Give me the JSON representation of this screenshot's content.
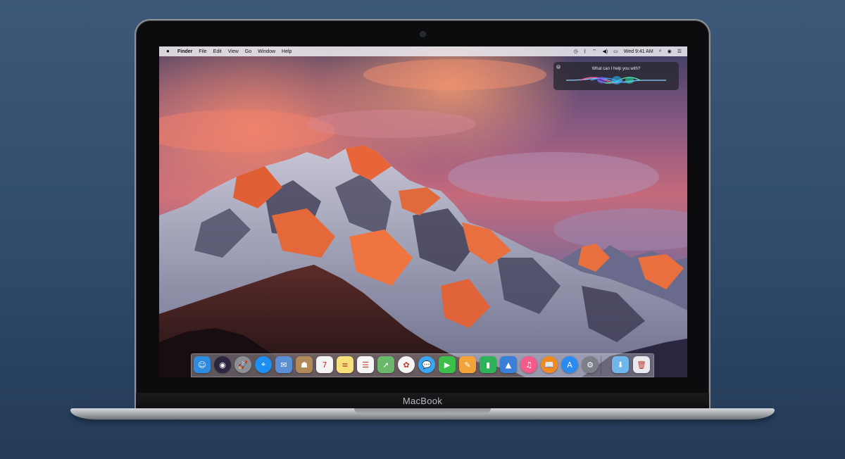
{
  "device": {
    "brand": "MacBook"
  },
  "menubar": {
    "apple_icon": "apple-logo-icon",
    "items": [
      "Finder",
      "File",
      "Edit",
      "View",
      "Go",
      "Window",
      "Help"
    ],
    "status_icons": [
      "time-machine-icon",
      "bluetooth-icon",
      "wifi-icon",
      "volume-icon",
      "battery-icon"
    ],
    "clock": "Wed 9:41 AM",
    "right_icons": [
      "spotlight-icon",
      "siri-icon",
      "notification-center-icon"
    ]
  },
  "siri": {
    "prompt": "What can I help you with?",
    "close_icon": "close-icon"
  },
  "dock": {
    "apps": [
      {
        "name": "finder",
        "glyph": "☺",
        "color": "#2e8be0"
      },
      {
        "name": "siri",
        "glyph": "◉",
        "color": "#2b2540"
      },
      {
        "name": "launchpad",
        "glyph": "🚀",
        "color": "#8c8f96"
      },
      {
        "name": "safari",
        "glyph": "⌖",
        "color": "#1d8ff0"
      },
      {
        "name": "mail",
        "glyph": "✉",
        "color": "#5a8fd4"
      },
      {
        "name": "contacts",
        "glyph": "☗",
        "color": "#b08a58"
      },
      {
        "name": "calendar",
        "glyph": "7",
        "color": "#f4f4f4"
      },
      {
        "name": "notes",
        "glyph": "≡",
        "color": "#f7e07a"
      },
      {
        "name": "reminders",
        "glyph": "☰",
        "color": "#f6f6f6"
      },
      {
        "name": "maps",
        "glyph": "➚",
        "color": "#6ab86a"
      },
      {
        "name": "photos",
        "glyph": "✿",
        "color": "#f5f5f5"
      },
      {
        "name": "messages",
        "glyph": "💬",
        "color": "#3aa7f5"
      },
      {
        "name": "facetime",
        "glyph": "▶",
        "color": "#3bbf4a"
      },
      {
        "name": "pages",
        "glyph": "✎",
        "color": "#f2a33a"
      },
      {
        "name": "numbers",
        "glyph": "▮",
        "color": "#2fb35a"
      },
      {
        "name": "keynote",
        "glyph": "▲",
        "color": "#3a7fd8"
      },
      {
        "name": "itunes",
        "glyph": "♫",
        "color": "#f25b8a"
      },
      {
        "name": "ibooks",
        "glyph": "📖",
        "color": "#f28a22"
      },
      {
        "name": "app-store",
        "glyph": "A",
        "color": "#2a8cf0"
      },
      {
        "name": "system-preferences",
        "glyph": "⚙",
        "color": "#7c7f86"
      }
    ],
    "right_items": [
      {
        "name": "downloads-folder",
        "glyph": "⬇",
        "color": "#6fb6ea"
      },
      {
        "name": "trash",
        "glyph": "🗑",
        "color": "#e8eaee"
      }
    ]
  }
}
